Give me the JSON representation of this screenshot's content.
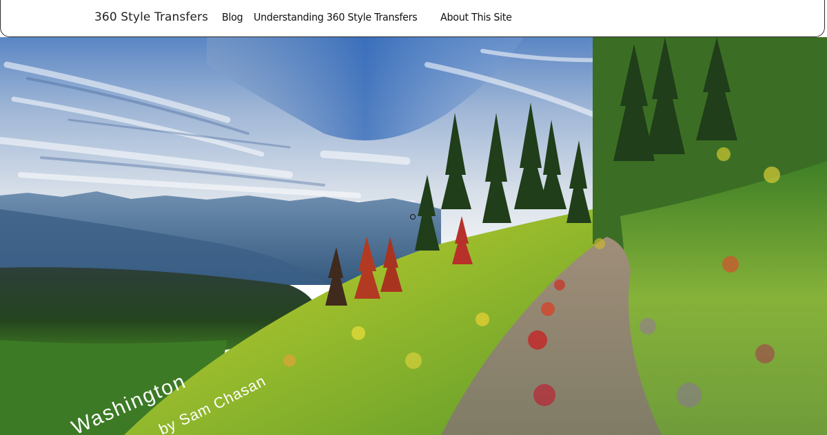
{
  "nav": {
    "site_title": "360 Style Transfers",
    "links": [
      {
        "label": "Blog"
      },
      {
        "label": "Understanding 360 Style Transfers"
      },
      {
        "label": "About This Site"
      }
    ]
  },
  "panorama": {
    "caption_line1": "Washington",
    "caption_line2": "by Sam Chasan"
  },
  "colors": {
    "sky_top": "#3f6fb0",
    "sky_light": "#c9d4e3",
    "mountains": "#4a6d90",
    "meadow": "#9fbf2f",
    "trees": "#2f5a22",
    "trail": "#8e8a72",
    "caption": "#ffffff"
  }
}
